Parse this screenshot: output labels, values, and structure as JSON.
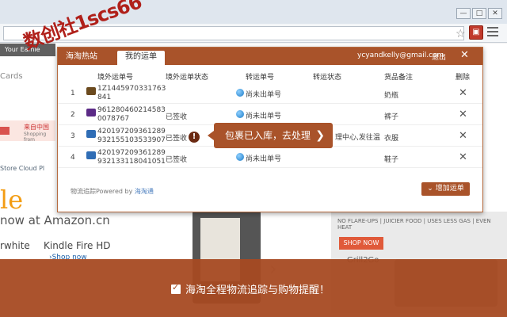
{
  "browser": {
    "window_buttons": [
      "—",
      "□",
      "✕"
    ],
    "star_icon": "star-icon",
    "extension_icon": "package-icon"
  },
  "background_page": {
    "amazon_strip": "Your Eamie",
    "cards": "Cards",
    "china_title": "来自中国",
    "china_sub": "Shopping from",
    "store_nav": "Store   Cloud Pl",
    "headline_fragment": "le",
    "now_at": "now at Amazon.cn",
    "white": "rwhite",
    "kindle_title": "Kindle Fire HD",
    "shop_now_link": "›Shop now",
    "promo_tag": "NO FLARE-UPS | JUICIER FOOD | USES LESS GAS | EVEN HEAT",
    "promo_button": "SHOP NOW",
    "promo_brand": "Grill2Go"
  },
  "popup": {
    "tabs": [
      {
        "label": "海淘热站",
        "active": false
      },
      {
        "label": "我的运单",
        "active": true
      }
    ],
    "user_email": "ycyandkelly@gmail.com",
    "logout": "退出",
    "close": "✕",
    "columns": {
      "tracking_no": "境外运单号",
      "tracking_status": "境外运单状态",
      "transfer_no": "转运单号",
      "transfer_status": "转运状态",
      "note": "货品备注",
      "delete": "删除"
    },
    "rows": [
      {
        "idx": "1",
        "carrier": "ups",
        "tracking_no": "1Z1445970331763 841",
        "status": "",
        "transfer_no": "尚未出单号",
        "transfer_status": "",
        "note": "奶瓶"
      },
      {
        "idx": "2",
        "carrier": "fedex",
        "tracking_no": "961280460214583 0078767",
        "status": "已签收",
        "transfer_no": "尚未出单号",
        "transfer_status": "",
        "note": "裤子"
      },
      {
        "idx": "3",
        "carrier": "usps",
        "tracking_no": "420197209361289 932155103533907",
        "status": "已签收",
        "transfer_no": "",
        "transfer_status": "理中心,发往温",
        "note": "衣服"
      },
      {
        "idx": "4",
        "carrier": "usps",
        "tracking_no": "420197209361289 932133118041051",
        "status": "已签收",
        "transfer_no": "尚未出单号",
        "transfer_status": "",
        "note": "鞋子"
      }
    ],
    "powered_prefix": "物流追踪Powered by ",
    "powered_brand": "海淘通",
    "add_button": "增加运单",
    "warning_symbol": "!",
    "tooltip_text": "包裹已入库，去处理",
    "tooltip_arrow": "❯"
  },
  "watermark": "数创社1scs66",
  "banner": {
    "text": "海淘全程物流追踪与购物提醒！",
    "checked": true
  },
  "colors": {
    "brand": "#a9532a",
    "banner": "#a64a22",
    "watermark": "#b0201a"
  }
}
